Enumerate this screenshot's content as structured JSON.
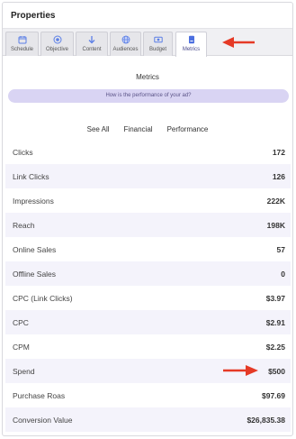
{
  "header": {
    "title": "Properties"
  },
  "tabs": [
    {
      "label": "Schedule",
      "icon": "calendar-icon"
    },
    {
      "label": "Objective",
      "icon": "target-icon"
    },
    {
      "label": "Content",
      "icon": "arrow-down-icon"
    },
    {
      "label": "Audiences",
      "icon": "globe-icon"
    },
    {
      "label": "Budget",
      "icon": "money-icon"
    },
    {
      "label": "Metrics",
      "icon": "document-icon",
      "active": true
    }
  ],
  "main": {
    "title": "Metrics",
    "question": "How is the performance of your ad?",
    "subtabs": [
      "See All",
      "Financial",
      "Performance"
    ]
  },
  "metrics": [
    {
      "label": "Clicks",
      "value": "172"
    },
    {
      "label": "Link Clicks",
      "value": "126"
    },
    {
      "label": "Impressions",
      "value": "222K"
    },
    {
      "label": "Reach",
      "value": "198K"
    },
    {
      "label": "Online Sales",
      "value": "57"
    },
    {
      "label": "Offline Sales",
      "value": "0"
    },
    {
      "label": "CPC (Link Clicks)",
      "value": "$3.97"
    },
    {
      "label": "CPC",
      "value": "$2.91"
    },
    {
      "label": "CPM",
      "value": "$2.25"
    },
    {
      "label": "Spend",
      "value": "$500"
    },
    {
      "label": "Purchase Roas",
      "value": "$97.69"
    },
    {
      "label": "Conversion Value",
      "value": "$26,835.38"
    }
  ],
  "colors": {
    "accent": "#4c6fe0",
    "annotation_arrow": "#e53a26",
    "pill_bg": "#d9d4f3",
    "row_alt": "#f4f3fb"
  }
}
